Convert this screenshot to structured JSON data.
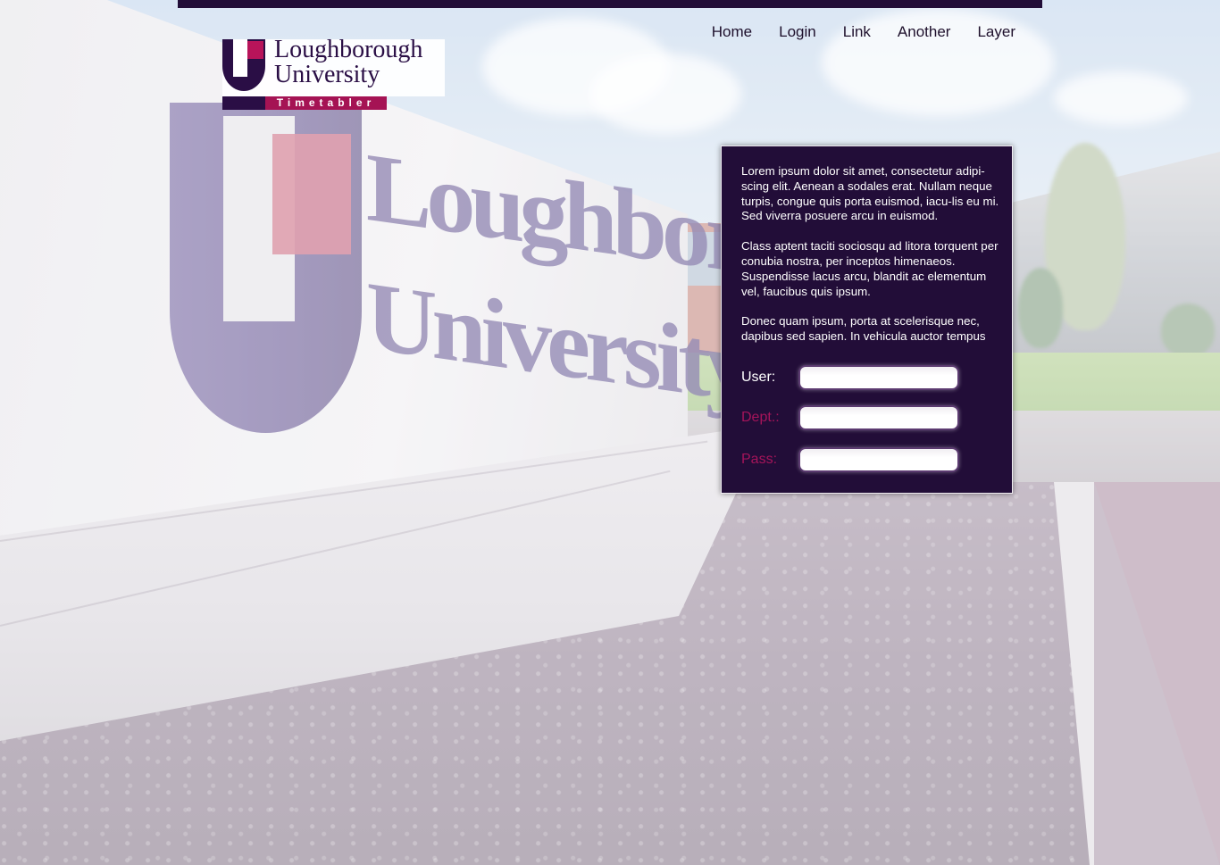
{
  "nav": {
    "items": [
      "Home",
      "Login",
      "Link",
      "Another",
      "Layer"
    ]
  },
  "logo": {
    "name_line1": "Loughborough",
    "name_line2": "University",
    "tag": "Timetabler"
  },
  "panel": {
    "paragraphs": [
      "Lorem ipsum dolor sit amet, consectetur adipi-scing elit. Aenean a sodales erat. Nullam neque turpis, congue quis porta euismod, iacu-lis eu mi. Sed viverra posuere arcu in euismod.",
      "Class aptent taciti sociosqu ad litora torquent per conubia nostra, per inceptos himenaeos. Suspendisse lacus arcu, blandit ac elementum vel, faucibus quis ipsum.",
      "Donec quam ipsum, porta at scelerisque nec, dapibus sed sapien. In vehicula auctor tempus"
    ],
    "fields": {
      "user_label": "User:",
      "user_value": "",
      "dept_label": "Dept.:",
      "dept_value": "",
      "pass_label": "Pass:",
      "pass_value": ""
    }
  },
  "colors": {
    "brand_dark": "#220d38",
    "brand_magenta": "#a5145a",
    "panel_text": "#ffffff"
  }
}
